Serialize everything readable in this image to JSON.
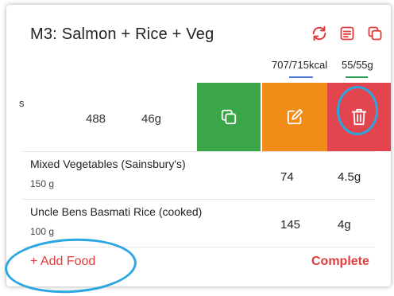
{
  "meal": {
    "title": "M3: Salmon + Rice + Veg",
    "totals": {
      "kcal": "707/715kcal",
      "grams": "55/55g"
    }
  },
  "header_icons": [
    "refresh-icon",
    "notes-icon",
    "copy-icon"
  ],
  "swiped_row": {
    "cut_text": "s",
    "kcal": "488",
    "grams": "46g",
    "actions": [
      {
        "name": "copy",
        "icon": "copy-icon",
        "color": "#3aa648"
      },
      {
        "name": "edit",
        "icon": "edit-icon",
        "color": "#f28c18"
      },
      {
        "name": "delete",
        "icon": "trash-icon",
        "color": "#e2454d"
      }
    ]
  },
  "foods": [
    {
      "name": "Mixed Vegetables (Sainsbury's)",
      "qty": "150 g",
      "kcal": "74",
      "grams": "4.5g"
    },
    {
      "name": "Uncle Bens Basmati Rice (cooked)",
      "qty": "100 g",
      "kcal": "145",
      "grams": "4g"
    }
  ],
  "footer": {
    "add_food": "+ Add Food",
    "complete": "Complete"
  },
  "colors": {
    "accent_red": "#e03c3c",
    "annotation_blue": "#2aa6e2",
    "kcal_underline": "#4a78d8",
    "grams_underline": "#2a9d55"
  }
}
